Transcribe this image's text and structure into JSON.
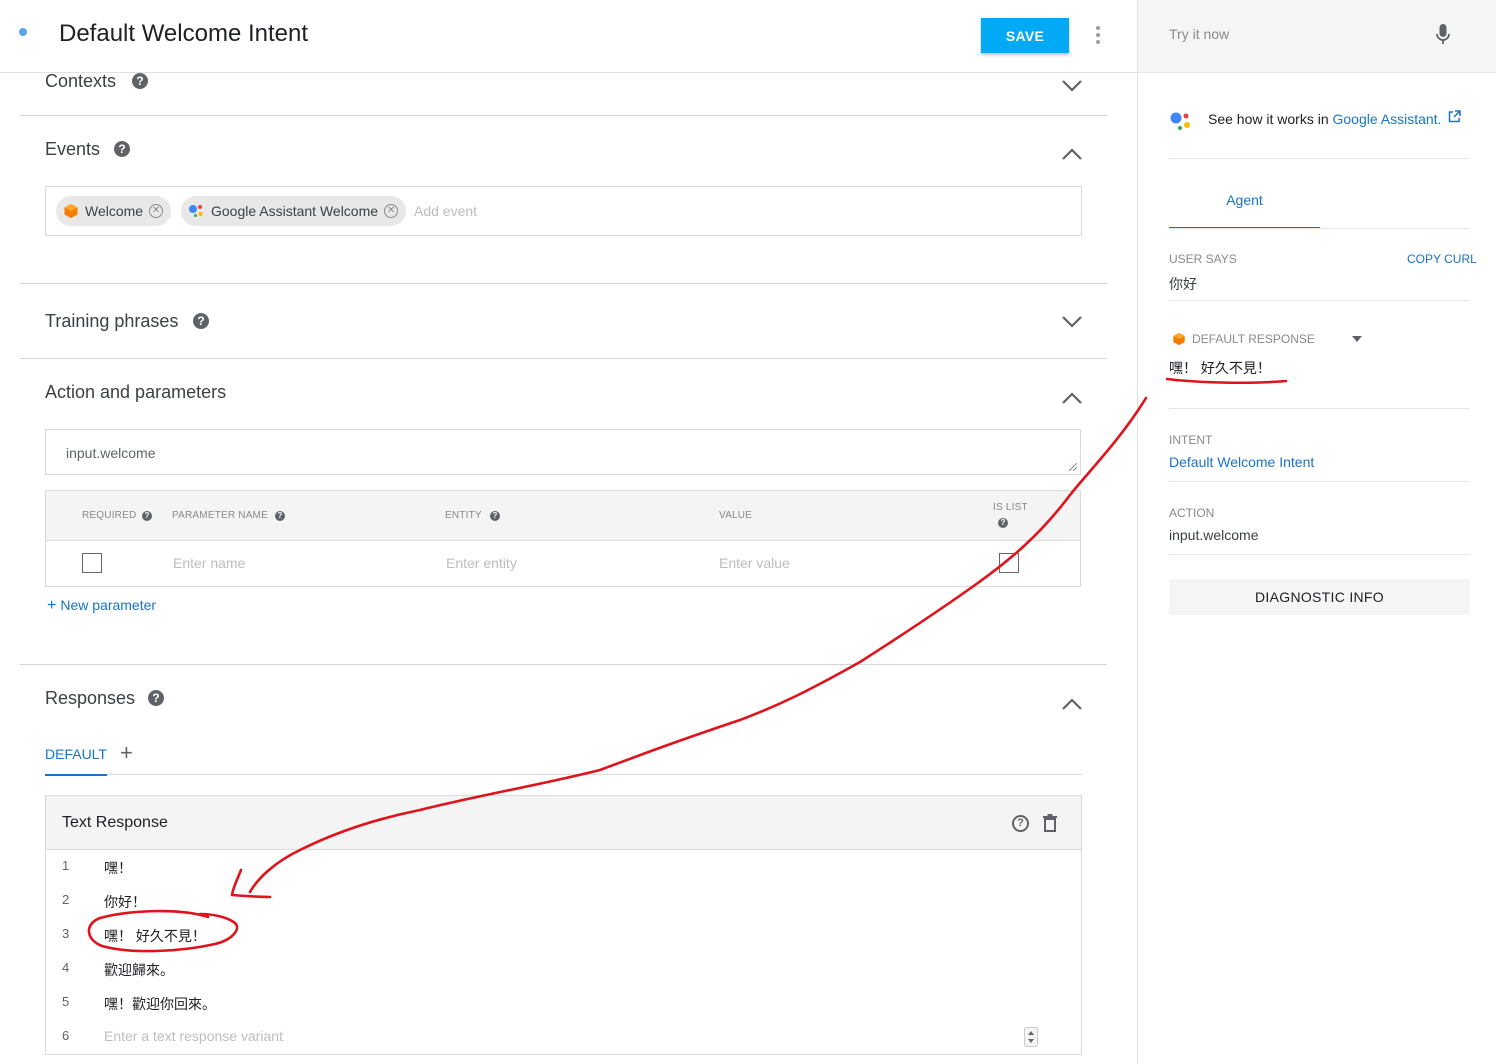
{
  "header": {
    "title": "Default Welcome Intent",
    "save_label": "SAVE"
  },
  "sections": {
    "contexts": "Contexts",
    "events": "Events",
    "training": "Training phrases",
    "action": "Action and parameters",
    "responses": "Responses"
  },
  "help_glyph": "?",
  "events": {
    "chips": [
      {
        "label": "Welcome",
        "icon": "dialogflow-icon"
      },
      {
        "label": "Google Assistant Welcome",
        "icon": "google-assistant-icon"
      }
    ],
    "placeholder": "Add event"
  },
  "action": {
    "value": "input.welcome",
    "columns": {
      "required": "REQUIRED",
      "parameter_name": "PARAMETER NAME",
      "entity": "ENTITY",
      "value": "VALUE",
      "is_list": "IS LIST"
    },
    "row_placeholders": {
      "name": "Enter name",
      "entity": "Enter entity",
      "value": "Enter value"
    },
    "new_parameter": "New parameter"
  },
  "responses": {
    "tab_default": "DEFAULT",
    "tab_add": "+",
    "card_title": "Text Response",
    "lines": [
      {
        "n": "1",
        "text": "嘿！"
      },
      {
        "n": "2",
        "text": "你好！"
      },
      {
        "n": "3",
        "text": "嘿！ 好久不見！"
      },
      {
        "n": "4",
        "text": "歡迎歸來。"
      },
      {
        "n": "5",
        "text": "嘿！歡迎你回來。"
      }
    ],
    "new_line_number": "6",
    "new_line_placeholder": "Enter a text response variant"
  },
  "side": {
    "try_placeholder": "Try it now",
    "see_how_prefix": "See how it works in ",
    "see_how_link": "Google Assistant.",
    "agent_tab": "Agent",
    "user_says_label": "USER SAYS",
    "copy_curl": "COPY CURL",
    "user_says_value": "你好",
    "default_response_label": "DEFAULT RESPONSE",
    "default_response_value": "嘿！ 好久不見！",
    "intent_label": "INTENT",
    "intent_value": "Default Welcome Intent",
    "action_label": "ACTION",
    "action_value": "input.welcome",
    "diagnostic": "DIAGNOSTIC INFO"
  },
  "colors": {
    "accent": "#1a73c8",
    "save": "#02a9f4",
    "annotation": "#e0121b"
  }
}
